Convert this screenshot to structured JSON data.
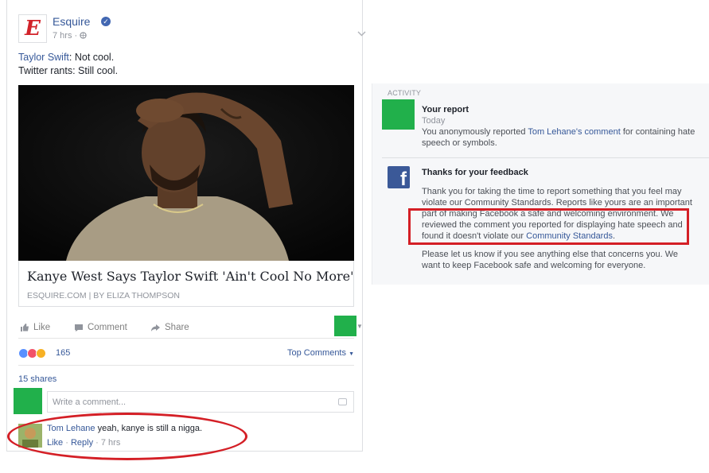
{
  "post": {
    "page_name": "Esquire",
    "logo_letter": "E",
    "time": "7 hrs ·",
    "text_line1_mention": "Taylor Swift",
    "text_line1_rest": ": Not cool.",
    "text_line2": "Twitter rants: Still cool.",
    "link_title": "Kanye West Says Taylor Swift 'Ain't Cool No More'",
    "link_source": "ESQUIRE.COM | BY ELIZA THOMPSON",
    "actions": {
      "like": "Like",
      "comment": "Comment",
      "share": "Share"
    },
    "reaction_count": "165",
    "top_comments": "Top Comments",
    "shares": "15 shares",
    "comment_placeholder": "Write a comment..."
  },
  "comment": {
    "author": "Tom Lehane",
    "text": " yeah, kanye is still a nigga.",
    "like": "Like",
    "reply": "Reply",
    "time": "7 hrs"
  },
  "activity": {
    "label": "ACTIVITY",
    "report": {
      "title": "Your report",
      "time": "Today",
      "text_before": "You anonymously reported ",
      "link": "Tom Lehane's comment",
      "text_after": " for containing hate speech or symbols."
    },
    "feedback": {
      "title": "Thanks for your feedback",
      "para1_before": "Thank you for taking the time to report something that you feel may violate our Community Standards. Reports like yours are an important part of making Facebook a safe and welcoming environment. We reviewed the comment you reported for displaying hate speech and found it doesn't violate our ",
      "para1_link": "Community Standards",
      "para1_after": ".",
      "para2": "Please let us know if you see anything else that concerns you. We want to keep Facebook safe and welcoming for everyone."
    }
  },
  "colors": {
    "link": "#365899",
    "annotation_red": "#d41f26",
    "placeholder_green": "#21b04b",
    "facebook_blue": "#3b5998",
    "esquire_red": "#d2232a"
  },
  "icons": [
    "verified-icon",
    "globe-icon",
    "chevron-down-icon",
    "like-icon",
    "comment-icon",
    "share-icon",
    "camera-icon",
    "facebook-icon"
  ]
}
